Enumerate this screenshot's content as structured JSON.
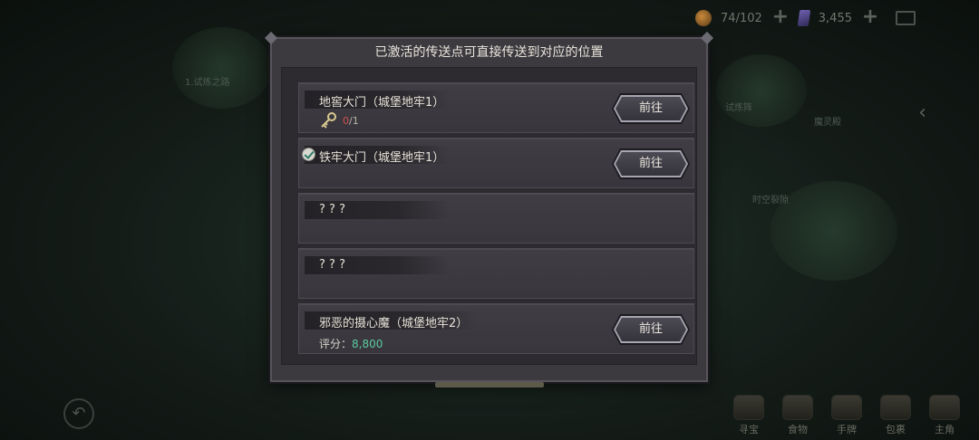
{
  "hud": {
    "stamina": "74/102",
    "crystals": "3,455"
  },
  "background_labels": [
    "1.试炼之路",
    "试炼阵",
    "魔灵殿",
    "时空裂隙"
  ],
  "bottom_menu": [
    {
      "label": "寻宝",
      "icon": "treasure-chest-icon"
    },
    {
      "label": "食物",
      "icon": "food-icon"
    },
    {
      "label": "手牌",
      "icon": "cards-icon"
    },
    {
      "label": "包裹",
      "icon": "bag-icon"
    },
    {
      "label": "主角",
      "icon": "hero-icon"
    }
  ],
  "modal": {
    "title": "已激活的传送点可直接传送到对应的位置",
    "entries": [
      {
        "name": "地窖大门（城堡地牢1）",
        "status": "locked",
        "key_current": "0",
        "key_total": "/1",
        "button": "前往"
      },
      {
        "name": "铁牢大门（城堡地牢1）",
        "status": "activated",
        "button": "前往"
      },
      {
        "name": "? ? ?",
        "status": "unknown"
      },
      {
        "name": "? ? ?",
        "status": "unknown"
      },
      {
        "name": "邪恶的摄心魔（城堡地牢2）",
        "status": "boss",
        "score_label": "评分：",
        "score_value": "8,800",
        "button": "前往"
      }
    ]
  },
  "colors": {
    "modal_bg": "#3c3a3f",
    "entry_bg": "#3e3c42",
    "score_green": "#5cc8a0",
    "key_count_red": "#d05050"
  }
}
